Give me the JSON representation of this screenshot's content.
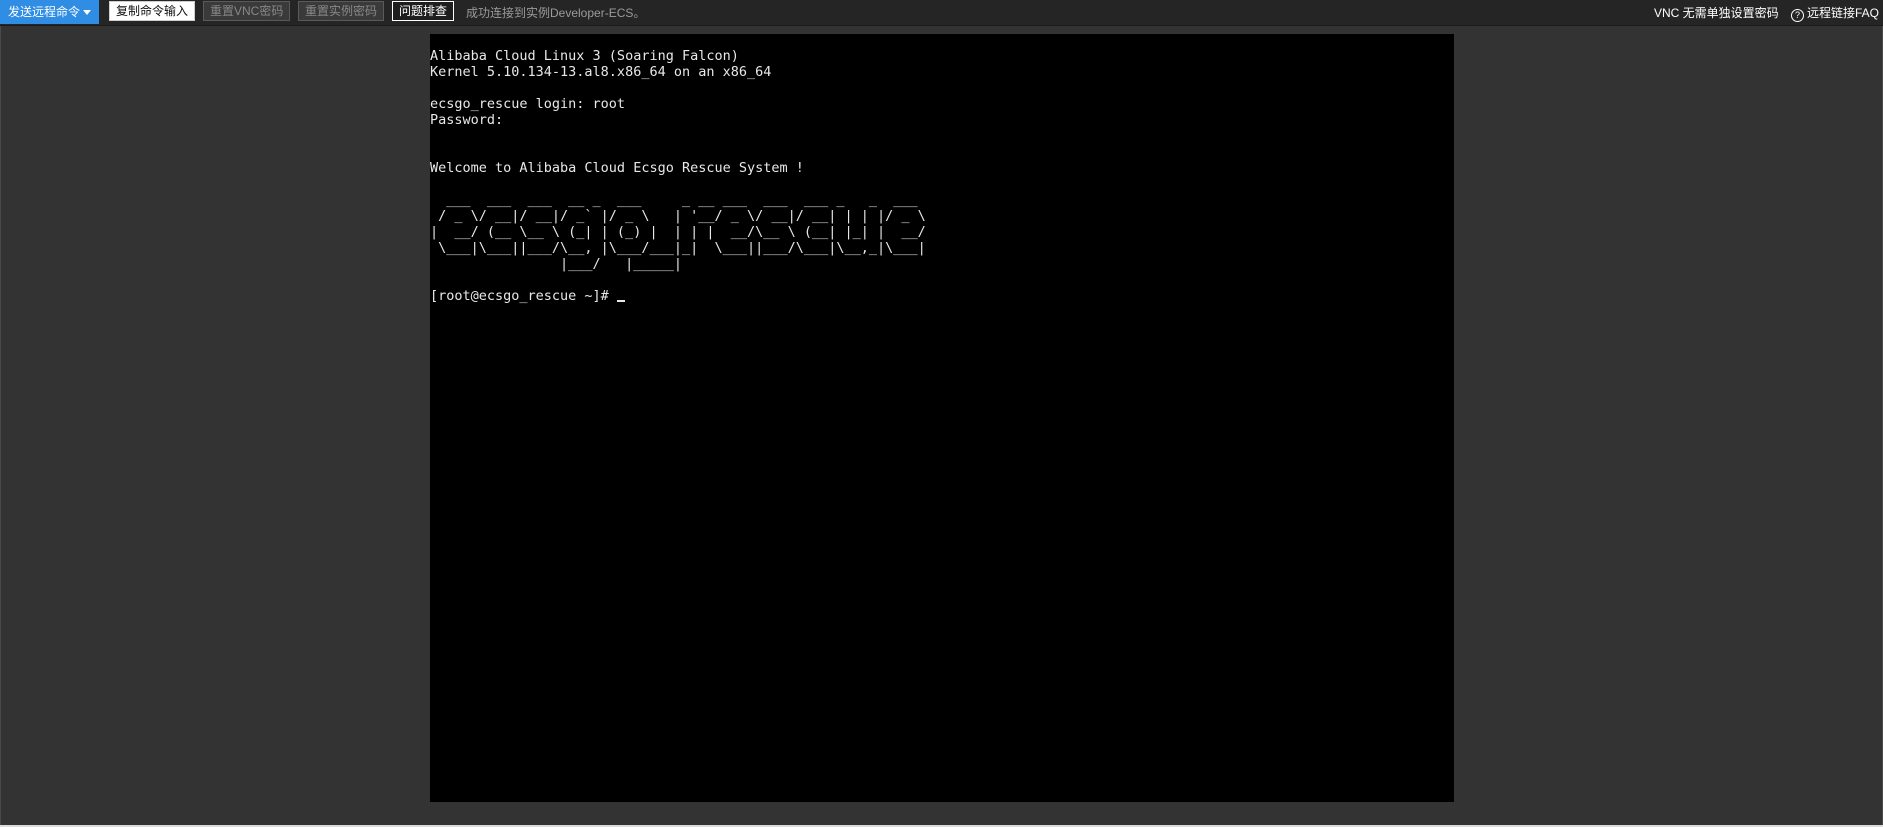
{
  "toolbar": {
    "send_command_label": "发送远程命令",
    "copy_input_label": "复制命令输入",
    "reset_vnc_label": "重置VNC密码",
    "reset_instance_label": "重置实例密码",
    "troubleshoot_label": "问题排查",
    "status_text": "成功连接到实例Developer-ECS。",
    "vnc_password_link": "VNC 无需单独设置密码",
    "faq_link": "远程链接FAQ",
    "help_icon_glyph": "?"
  },
  "terminal": {
    "lines": [
      "Alibaba Cloud Linux 3 (Soaring Falcon)",
      "Kernel 5.10.134-13.al8.x86_64 on an x86_64",
      "",
      "ecsgo_rescue login: root",
      "Password:",
      "",
      "",
      "Welcome to Alibaba Cloud Ecsgo Rescue System !",
      "",
      "  ___  ___  ___  __ _  ___     _ __ ___  ___  ___ _   _  ___",
      " / _ \\/ __|/ __|/ _` |/ _ \\   | '__/ _ \\/ __|/ __| | | |/ _ \\",
      "|  __/ (__ \\__ \\ (_| | (_) |  | | |  __/\\__ \\ (__| |_| |  __/",
      " \\___|\\___||___/\\__, |\\___/___|_|  \\___||___/\\___|\\__,_|\\___|",
      "                |___/   |_____|",
      "",
      "[root@ecsgo_rescue ~]# "
    ]
  },
  "colors": {
    "primary": "#2f8de4",
    "background": "#333333",
    "console_bg": "#000000",
    "terminal_text": "#e8e8e8"
  }
}
